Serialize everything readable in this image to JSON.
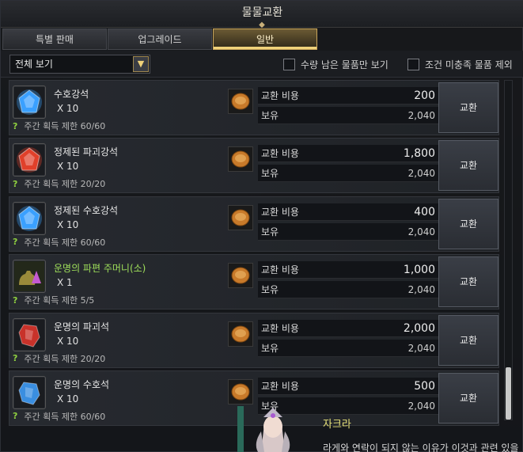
{
  "window": {
    "title": "물물교환"
  },
  "tabs": [
    {
      "label": "특별 판매",
      "active": false
    },
    {
      "label": "업그레이드",
      "active": false
    },
    {
      "label": "일반",
      "active": true
    }
  ],
  "filter": {
    "select_value": "전체 보기",
    "checkbox_stock": "수량 남은 물품만 보기",
    "checkbox_cond": "조건 미충족 물품 제외"
  },
  "cost_label": "교환 비용",
  "owned_label": "보유",
  "exchange_label": "교환",
  "items": [
    {
      "name": "수호강석",
      "qty": "X 10",
      "limit": "주간 획득 제한 60/60",
      "cost": "200",
      "owned": "2,040",
      "icon": "blue-crystal-icon",
      "color": "#3aa0ff",
      "green": false
    },
    {
      "name": "정제된 파괴강석",
      "qty": "X 10",
      "limit": "주간 획득 제한 20/20",
      "cost": "1,800",
      "owned": "2,040",
      "icon": "red-crystal-icon",
      "color": "#e0402a",
      "green": false
    },
    {
      "name": "정제된 수호강석",
      "qty": "X 10",
      "limit": "주간 획득 제한 60/60",
      "cost": "400",
      "owned": "2,040",
      "icon": "blue-crystal-icon",
      "color": "#3aa0ff",
      "green": false
    },
    {
      "name": "운명의 파편 주머니(소)",
      "qty": "X 1",
      "limit": "주간 획득 제한 5/5",
      "cost": "1,000",
      "owned": "2,040",
      "icon": "pouch-icon",
      "color": "#c45ad0",
      "green": true
    },
    {
      "name": "운명의 파괴석",
      "qty": "X 10",
      "limit": "주간 획득 제한 20/20",
      "cost": "2,000",
      "owned": "2,040",
      "icon": "red-stone-icon",
      "color": "#c8322a",
      "green": false
    },
    {
      "name": "운명의 수호석",
      "qty": "X 10",
      "limit": "주간 획득 제한 60/60",
      "cost": "500",
      "owned": "2,040",
      "icon": "blue-stone-icon",
      "color": "#3a8ee0",
      "green": false
    }
  ],
  "npc": {
    "name": "자크라",
    "dialog": "라게와 연락이 되지 않는 이유가 이것과 관련 있을"
  }
}
